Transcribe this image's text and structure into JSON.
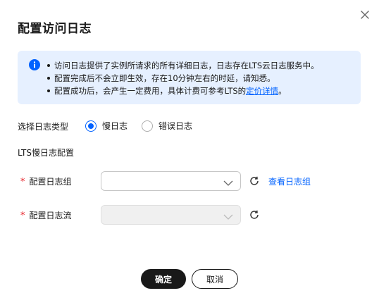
{
  "dialog": {
    "title": "配置访问日志",
    "close_icon": "close-icon"
  },
  "notice": {
    "icon": "info-icon",
    "accent_color": "#0062ff",
    "background_color": "#e6f0ff",
    "line1": "访问日志提供了实例所请求的所有详细日志，日志存在LTS云日志服务中。",
    "line2": "配置完成后不会立即生效，存在10分钟左右的时延，请知悉。",
    "line3_prefix": "配置成功后，会产生一定费用，具体计费可参考LTS的",
    "line3_link": "定价详情",
    "line3_suffix": "。"
  },
  "log_type": {
    "label": "选择日志类型",
    "options": [
      {
        "label": "慢日志",
        "checked": true
      },
      {
        "label": "错误日志",
        "checked": false
      }
    ]
  },
  "section": {
    "title": "LTS慢日志配置"
  },
  "log_group": {
    "required_mark": "*",
    "label": "配置日志组",
    "selected_value": "",
    "view_link": "查看日志组"
  },
  "log_stream": {
    "required_mark": "*",
    "label": "配置日志流",
    "selected_value": "",
    "disabled": true
  },
  "footer": {
    "confirm_label": "确定",
    "cancel_label": "取消"
  }
}
